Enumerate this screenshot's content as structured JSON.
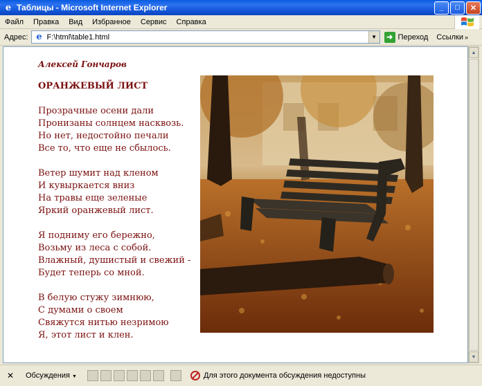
{
  "window": {
    "title": "Таблицы - Microsoft Internet Explorer"
  },
  "menu": [
    "Файл",
    "Правка",
    "Вид",
    "Избранное",
    "Сервис",
    "Справка"
  ],
  "address": {
    "label": "Адрес:",
    "value": "F:\\html\\table1.html",
    "go_label": "Переход",
    "links_label": "Ссылки"
  },
  "poem": {
    "author": "Алексей Гончаров",
    "title": "ОРАНЖЕВЫЙ ЛИСТ",
    "stanzas": [
      [
        "Прозрачные осени дали",
        "Пронизаны солнцем насквозь.",
        "Но нет, недостойно печали",
        "Все то, что еще не сбылось."
      ],
      [
        "Ветер шумит над кленом",
        "И кувыркается вниз",
        "На травы еще зеленые",
        "Яркий оранжевый лист."
      ],
      [
        "Я подниму его бережно,",
        "Возьму из леса с собой.",
        "Влажный, душистый и свежий -",
        "Будет теперь со мной."
      ],
      [
        "В белую стужу зимнюю,",
        "С думами о своем",
        "Свяжутся нитью незримою",
        "Я, этот лист и клен."
      ]
    ]
  },
  "statusbar": {
    "discussions": "Обсуждения",
    "message": "Для этого документа обсуждения недоступны"
  },
  "colors": {
    "poem_text": "#7a0f0f",
    "titlebar": "#0a5be0"
  },
  "icons": [
    "ie-icon",
    "minimize-icon",
    "maximize-icon",
    "close-icon",
    "windows-logo-icon",
    "go-arrow-icon",
    "stop-icon"
  ]
}
